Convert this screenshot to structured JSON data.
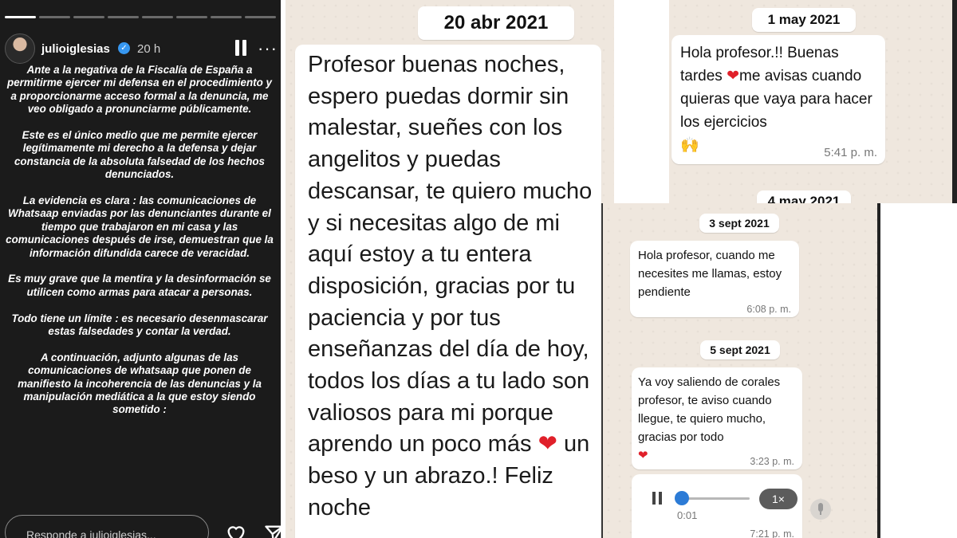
{
  "story": {
    "username": "julioiglesias",
    "time": "20 h",
    "reply_placeholder": "Responde a julioiglesias...",
    "paragraphs": [
      "Ante a la negativa de la Fiscalía de España a permitirme ejercer mi defensa en el procedimiento y a proporcionarme acceso formal a la denuncia, me veo obligado a pronunciarme públicamente.",
      "Este es el único medio que me permite ejercer legítimamente mi derecho a la defensa y dejar constancia de la absoluta falsedad de los hechos denunciados.",
      "La evidencia es clara : las comunicaciones de Whatsaap enviadas por las denunciantes durante el tiempo que trabajaron en mi casa y las comunicaciones después de irse, demuestran que la información difundida carece de veracidad.",
      "Es muy grave que la mentira y la desinformación se utilicen como armas para atacar a personas.",
      "Todo tiene un límite : es necesario desenmascarar estas falsedades y contar la verdad.",
      "A continuación,  adjunto algunas de las comunicaciones de whatsaap que ponen de manifiesto la incoherencia de las denuncias y la manipulación mediática a la que estoy siendo sometido :"
    ]
  },
  "chat1": {
    "date": "20 abr 2021",
    "message_a": "Profesor buenas noches, espero puedas dormir sin malestar, sueñes con los angelitos y puedas descansar, te quiero mucho y si necesitas algo de mi aquí estoy a tu entera disposición, gracias por tu paciencia y por tus enseñanzas del día de hoy, todos los días a tu lado son valiosos para mi porque aprendo un poco más",
    "emoji_heart": "❤",
    "message_b": " un beso y un abrazo.! Feliz noche"
  },
  "chat2": {
    "date": "1 may 2021",
    "message_a": "Hola profesor.!! Buenas tardes ",
    "emoji_heart": "❤",
    "message_b": "me avisas cuando quieras que vaya para hacer los ejercicios",
    "emoji_hands": "🙌",
    "time": "5:41 p. m.",
    "next_date": "4 may 2021"
  },
  "chat3": {
    "date_a": "3 sept 2021",
    "message_a": "Hola profesor, cuando me necesites me llamas, estoy pendiente",
    "time_a": "6:08 p. m.",
    "date_b": "5 sept 2021",
    "message_b": "Ya voy saliendo de corales profesor, te aviso cuando llegue, te quiero mucho, gracias por todo",
    "emoji_heart": "❤",
    "time_b": "3:23 p. m.",
    "audio_duration": "0:01",
    "audio_speed": "1×",
    "time_c": "7:21 p. m."
  }
}
